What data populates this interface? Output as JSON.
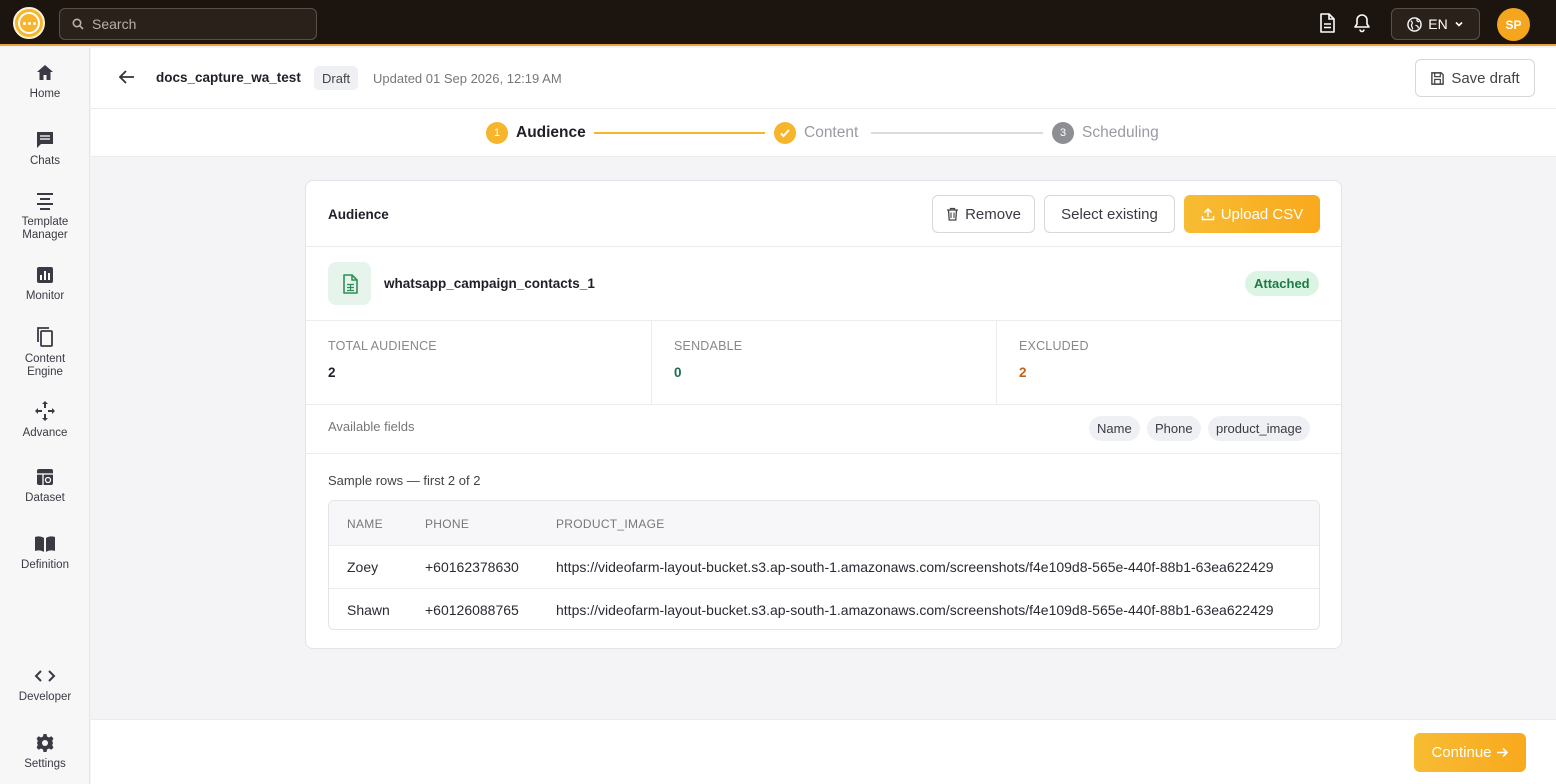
{
  "topbar": {
    "search_placeholder": "Search",
    "language": "EN",
    "avatar_initials": "SP"
  },
  "sidebar": {
    "items": [
      {
        "label": "Home",
        "icon": "home-icon"
      },
      {
        "label": "Chats",
        "icon": "chat-icon"
      },
      {
        "label": "Template Manager",
        "icon": "template-icon"
      },
      {
        "label": "Monitor",
        "icon": "monitor-icon"
      },
      {
        "label": "Content Engine",
        "icon": "copy-icon"
      },
      {
        "label": "Advance",
        "icon": "arrows-icon"
      },
      {
        "label": "Dataset",
        "icon": "dataset-icon"
      },
      {
        "label": "Definition",
        "icon": "book-icon"
      },
      {
        "label": "Developer",
        "icon": "code-icon"
      },
      {
        "label": "Settings",
        "icon": "gear-icon"
      }
    ]
  },
  "header": {
    "campaign_name": "docs_capture_wa_test",
    "status": "Draft",
    "updated": "Updated 01 Sep 2026, 12:19 AM",
    "save_label": "Save draft"
  },
  "stepper": {
    "steps": [
      {
        "number": "1",
        "label": "Audience",
        "state": "active"
      },
      {
        "number": "2",
        "label": "Content",
        "state": "complete"
      },
      {
        "number": "3",
        "label": "Scheduling",
        "state": "pending"
      }
    ]
  },
  "audience": {
    "title": "Audience",
    "remove_label": "Remove",
    "select_label": "Select existing",
    "upload_label": "Upload CSV",
    "file_name": "whatsapp_campaign_contacts_1",
    "file_status": "Attached",
    "stats": [
      {
        "label": "TOTAL AUDIENCE",
        "value": "2",
        "color": "#1f1f29"
      },
      {
        "label": "SENDABLE",
        "value": "0",
        "color": "#1d6b57"
      },
      {
        "label": "EXCLUDED",
        "value": "2",
        "color": "#c2621a"
      }
    ],
    "fields_label": "Available fields",
    "fields": [
      "Name",
      "Phone",
      "product_image"
    ],
    "sample_label": "Sample rows — first 2 of 2",
    "columns": [
      "NAME",
      "PHONE",
      "PRODUCT_IMAGE"
    ],
    "rows": [
      [
        "Zoey",
        "+60162378630",
        "https://videofarm-layout-bucket.s3.ap-south-1.amazonaws.com/screenshots/f4e109d8-565e-440f-88b1-63ea622429"
      ],
      [
        "Shawn",
        "+60126088765",
        "https://videofarm-layout-bucket.s3.ap-south-1.amazonaws.com/screenshots/f4e109d8-565e-440f-88b1-63ea622429"
      ]
    ]
  },
  "footer": {
    "continue_label": "Continue"
  },
  "colors": {
    "accent": "#f9a91d",
    "topbar": "#1c140f"
  }
}
